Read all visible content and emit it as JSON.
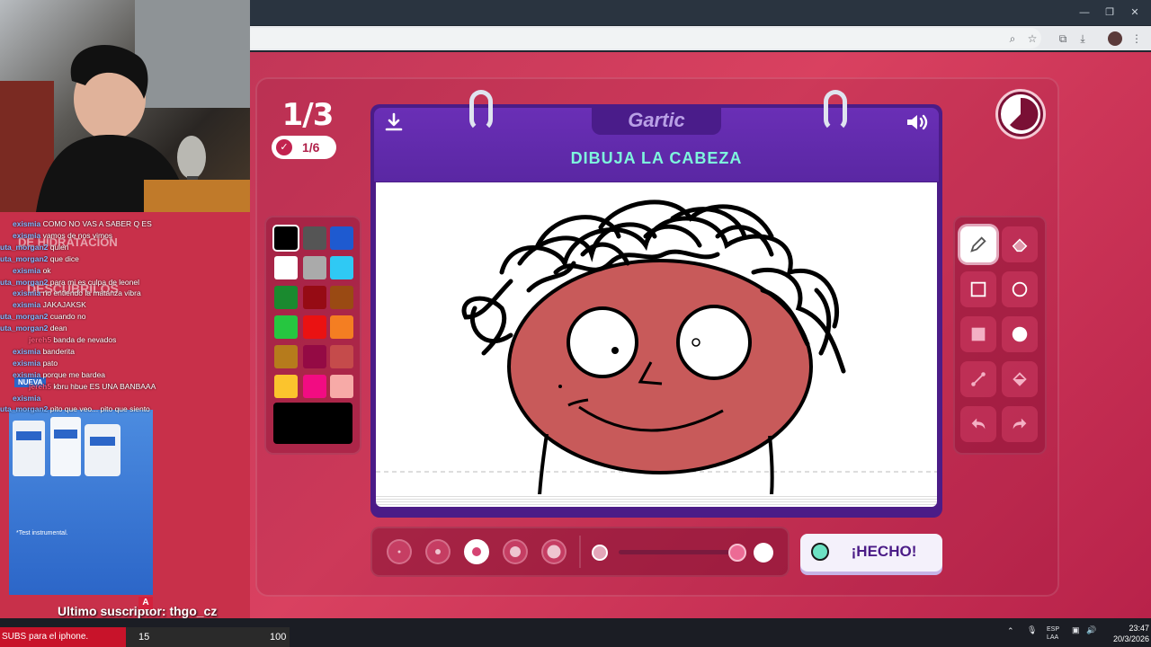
{
  "game": {
    "round": "1/3",
    "progress": "1/6",
    "logo": "Gartic",
    "prompt": "DIBUJA LA CABEZA",
    "done_label": "¡HECHO!"
  },
  "palette": {
    "colors": [
      "#000000",
      "#555555",
      "#1e5ad0",
      "#ffffff",
      "#aaaaaa",
      "#2fc9f4",
      "#1a8a2f",
      "#960b14",
      "#9a4a13",
      "#26c640",
      "#ea1212",
      "#f47e22",
      "#b67b1c",
      "#940a44",
      "#c54b4b",
      "#fbc42d",
      "#f20c82",
      "#f7aaa7"
    ],
    "current_color": "#000000"
  },
  "tools": {
    "items": [
      "pencil-icon",
      "eraser-icon",
      "square-outline-icon",
      "circle-outline-icon",
      "square-fill-icon",
      "circle-fill-icon",
      "line-icon",
      "fill-bucket-icon",
      "undo-icon",
      "redo-icon"
    ],
    "active": "pencil-icon"
  },
  "brush": {
    "sizes": 5,
    "active_index": 2,
    "opacity": 1.0
  },
  "chat": {
    "lines": [
      {
        "user": "exismia",
        "text": "COMO NO VAS A SABER Q ES"
      },
      {
        "user": "exismia",
        "text": "vamos de nos vimos"
      },
      {
        "user": "uta_morgan2",
        "text": "quien"
      },
      {
        "user": "uta_morgan2",
        "text": "que dice"
      },
      {
        "user": "exismia",
        "text": "ok"
      },
      {
        "user": "uta_morgan2",
        "text": "para mi es culpa de leonel"
      },
      {
        "user": "exismia",
        "text": "no entiendo la matanza vibra"
      },
      {
        "user": "exismia",
        "text": "JAKAJAKSK"
      },
      {
        "user": "uta_morgan2",
        "text": "cuando no"
      },
      {
        "user": "uta_morgan2",
        "text": "dean"
      },
      {
        "user": "jereh5",
        "text": "banda de nevados"
      },
      {
        "user": "exismia",
        "text": "banderita"
      },
      {
        "user": "exismia",
        "text": "pato"
      },
      {
        "user": "exismia",
        "text": "porque me bardea"
      },
      {
        "user": "jereh5",
        "text": "kbru hbue ES UNA BANBAAA"
      },
      {
        "user": "exismia",
        "text": ""
      },
      {
        "user": "uta_morgan2",
        "text": "pito que veo... pito que siento"
      }
    ]
  },
  "overlay": {
    "ad_headline_1": "DE HIDRATACIÓN",
    "ad_headline_2": "DESCUBRILOS",
    "ad_badge": "NUEVA",
    "ad_footnote": "*Test instrumental.",
    "last_sub": "Ultimo suscriptor: thgo_cz",
    "sub_badge": "A",
    "subs_text": "SUBS para el iphone.",
    "subs_count": "15",
    "subs_goal": "100"
  },
  "taskbar": {
    "lang": "ESP\nLAA",
    "time": "23:47",
    "date": "20/3/2026"
  }
}
